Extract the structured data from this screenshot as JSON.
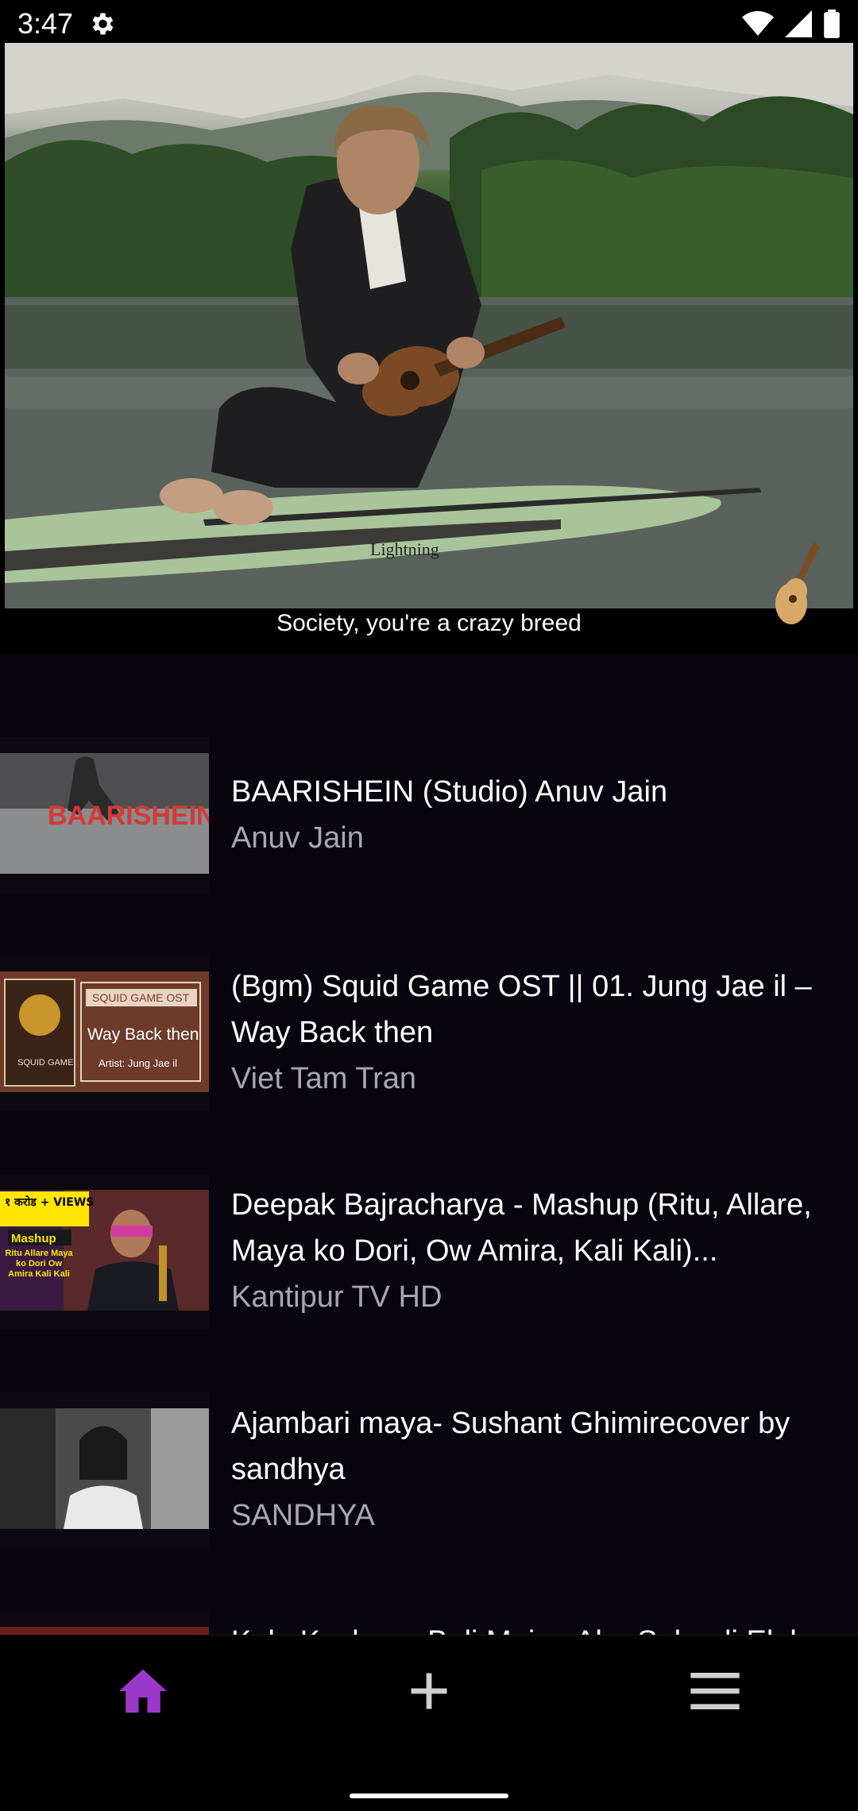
{
  "status_bar": {
    "time": "3:47"
  },
  "hero": {
    "caption": "Society, you're a crazy breed"
  },
  "items": [
    {
      "title": "BAARISHEIN (Studio) Anuv Jain",
      "artist": "Anuv Jain",
      "thumb_text": "BAARISHEIN"
    },
    {
      "title": "(Bgm) Squid Game OST || 01. Jung Jae il – Way Back then",
      "artist": "Viet Tam Tran",
      "thumb_badge": "SQUID GAME OST",
      "thumb_title": "Way Back then",
      "thumb_artist": "Artist: Jung Jae il",
      "thumb_poster": "SQUID GAME"
    },
    {
      "title": "Deepak Bajracharya - Mashup (Ritu, Allare, Maya ko Dori, Ow Amira, Kali Kali)...",
      "artist": "Kantipur TV HD",
      "thumb_views": "१ करोड + VIEWS",
      "thumb_mashup": "Mashup",
      "thumb_songs": "Ritu Allare Maya ko Dori Ow Amira Kali Kali"
    },
    {
      "title": "Ajambari maya- Sushant Ghimirecover by sandhya",
      "artist": "SANDHYA"
    },
    {
      "title": "Kalo Kesh ma Buli Mai ... Aba Sahanli Ek la",
      "artist": ""
    }
  ],
  "nav": {
    "home_icon": "home-icon",
    "add_icon": "plus-icon",
    "menu_icon": "menu-icon",
    "active_color": "#9b38c9"
  },
  "colors": {
    "background": "#08050f",
    "artist_text": "#a9a7ae"
  }
}
